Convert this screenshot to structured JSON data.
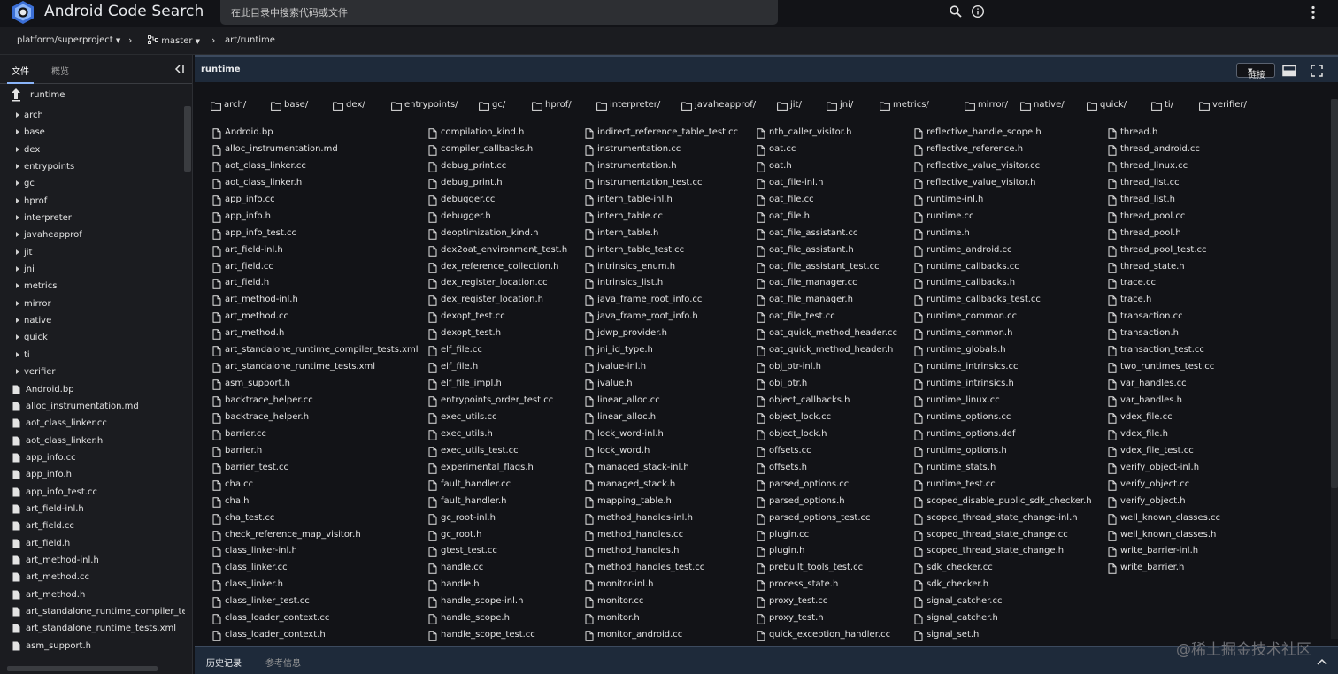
{
  "app": {
    "title": "Android Code Search",
    "search_placeholder": "在此目录中搜索代码或文件",
    "icons": {
      "logo": "android-code-search-logo",
      "search": "search-icon",
      "info": "info-icon",
      "more": "more-vert-icon"
    }
  },
  "breadcrumb": {
    "project": "platform/superproject",
    "branch": "master",
    "path": "art/runtime"
  },
  "sidebar": {
    "tabs": {
      "files": "文件",
      "overview": "概览"
    },
    "up_label": "runtime",
    "folders": [
      "arch",
      "base",
      "dex",
      "entrypoints",
      "gc",
      "hprof",
      "interpreter",
      "javaheapprof",
      "jit",
      "jni",
      "metrics",
      "mirror",
      "native",
      "quick",
      "ti",
      "verifier"
    ],
    "files": [
      "Android.bp",
      "alloc_instrumentation.md",
      "aot_class_linker.cc",
      "aot_class_linker.h",
      "app_info.cc",
      "app_info.h",
      "app_info_test.cc",
      "art_field-inl.h",
      "art_field.cc",
      "art_field.h",
      "art_method-inl.h",
      "art_method.cc",
      "art_method.h",
      "art_standalone_runtime_compiler_test",
      "art_standalone_runtime_tests.xml",
      "asm_support.h"
    ]
  },
  "main": {
    "title": "runtime",
    "link_button": "链接",
    "directories": [
      "arch/",
      "base/",
      "dex/",
      "entrypoints/",
      "gc/",
      "hprof/",
      "interpreter/",
      "javaheapprof/",
      "jit/",
      "jni/",
      "metrics/",
      "mirror/",
      "native/",
      "quick/",
      "ti/",
      "verifier/"
    ],
    "columns": [
      [
        "Android.bp",
        "alloc_instrumentation.md",
        "aot_class_linker.cc",
        "aot_class_linker.h",
        "app_info.cc",
        "app_info.h",
        "app_info_test.cc",
        "art_field-inl.h",
        "art_field.cc",
        "art_field.h",
        "art_method-inl.h",
        "art_method.cc",
        "art_method.h",
        "art_standalone_runtime_compiler_tests.xml",
        "art_standalone_runtime_tests.xml",
        "asm_support.h",
        "backtrace_helper.cc",
        "backtrace_helper.h",
        "barrier.cc",
        "barrier.h",
        "barrier_test.cc",
        "cha.cc",
        "cha.h",
        "cha_test.cc",
        "check_reference_map_visitor.h",
        "class_linker-inl.h",
        "class_linker.cc",
        "class_linker.h",
        "class_linker_test.cc",
        "class_loader_context.cc",
        "class_loader_context.h"
      ],
      [
        "compilation_kind.h",
        "compiler_callbacks.h",
        "debug_print.cc",
        "debug_print.h",
        "debugger.cc",
        "debugger.h",
        "deoptimization_kind.h",
        "dex2oat_environment_test.h",
        "dex_reference_collection.h",
        "dex_register_location.cc",
        "dex_register_location.h",
        "dexopt_test.cc",
        "dexopt_test.h",
        "elf_file.cc",
        "elf_file.h",
        "elf_file_impl.h",
        "entrypoints_order_test.cc",
        "exec_utils.cc",
        "exec_utils.h",
        "exec_utils_test.cc",
        "experimental_flags.h",
        "fault_handler.cc",
        "fault_handler.h",
        "gc_root-inl.h",
        "gc_root.h",
        "gtest_test.cc",
        "handle.cc",
        "handle.h",
        "handle_scope-inl.h",
        "handle_scope.h",
        "handle_scope_test.cc"
      ],
      [
        "indirect_reference_table_test.cc",
        "instrumentation.cc",
        "instrumentation.h",
        "instrumentation_test.cc",
        "intern_table-inl.h",
        "intern_table.cc",
        "intern_table.h",
        "intern_table_test.cc",
        "intrinsics_enum.h",
        "intrinsics_list.h",
        "java_frame_root_info.cc",
        "java_frame_root_info.h",
        "jdwp_provider.h",
        "jni_id_type.h",
        "jvalue-inl.h",
        "jvalue.h",
        "linear_alloc.cc",
        "linear_alloc.h",
        "lock_word-inl.h",
        "lock_word.h",
        "managed_stack-inl.h",
        "managed_stack.h",
        "mapping_table.h",
        "method_handles-inl.h",
        "method_handles.cc",
        "method_handles.h",
        "method_handles_test.cc",
        "monitor-inl.h",
        "monitor.cc",
        "monitor.h",
        "monitor_android.cc"
      ],
      [
        "nth_caller_visitor.h",
        "oat.cc",
        "oat.h",
        "oat_file-inl.h",
        "oat_file.cc",
        "oat_file.h",
        "oat_file_assistant.cc",
        "oat_file_assistant.h",
        "oat_file_assistant_test.cc",
        "oat_file_manager.cc",
        "oat_file_manager.h",
        "oat_file_test.cc",
        "oat_quick_method_header.cc",
        "oat_quick_method_header.h",
        "obj_ptr-inl.h",
        "obj_ptr.h",
        "object_callbacks.h",
        "object_lock.cc",
        "object_lock.h",
        "offsets.cc",
        "offsets.h",
        "parsed_options.cc",
        "parsed_options.h",
        "parsed_options_test.cc",
        "plugin.cc",
        "plugin.h",
        "prebuilt_tools_test.cc",
        "process_state.h",
        "proxy_test.cc",
        "proxy_test.h",
        "quick_exception_handler.cc"
      ],
      [
        "reflective_handle_scope.h",
        "reflective_reference.h",
        "reflective_value_visitor.cc",
        "reflective_value_visitor.h",
        "runtime-inl.h",
        "runtime.cc",
        "runtime.h",
        "runtime_android.cc",
        "runtime_callbacks.cc",
        "runtime_callbacks.h",
        "runtime_callbacks_test.cc",
        "runtime_common.cc",
        "runtime_common.h",
        "runtime_globals.h",
        "runtime_intrinsics.cc",
        "runtime_intrinsics.h",
        "runtime_linux.cc",
        "runtime_options.cc",
        "runtime_options.def",
        "runtime_options.h",
        "runtime_stats.h",
        "runtime_test.cc",
        "scoped_disable_public_sdk_checker.h",
        "scoped_thread_state_change-inl.h",
        "scoped_thread_state_change.cc",
        "scoped_thread_state_change.h",
        "sdk_checker.cc",
        "sdk_checker.h",
        "signal_catcher.cc",
        "signal_catcher.h",
        "signal_set.h"
      ],
      [
        "thread.h",
        "thread_android.cc",
        "thread_linux.cc",
        "thread_list.cc",
        "thread_list.h",
        "thread_pool.cc",
        "thread_pool.h",
        "thread_pool_test.cc",
        "thread_state.h",
        "trace.cc",
        "trace.h",
        "transaction.cc",
        "transaction.h",
        "transaction_test.cc",
        "two_runtimes_test.cc",
        "var_handles.cc",
        "var_handles.h",
        "vdex_file.cc",
        "vdex_file.h",
        "vdex_file_test.cc",
        "verify_object-inl.h",
        "verify_object.cc",
        "verify_object.h",
        "well_known_classes.cc",
        "well_known_classes.h",
        "write_barrier-inl.h",
        "write_barrier.h"
      ]
    ]
  },
  "bottom_panel": {
    "tabs": {
      "history": "历史记录",
      "references": "参考信息"
    }
  },
  "watermark": "@稀土掘金技术社区"
}
